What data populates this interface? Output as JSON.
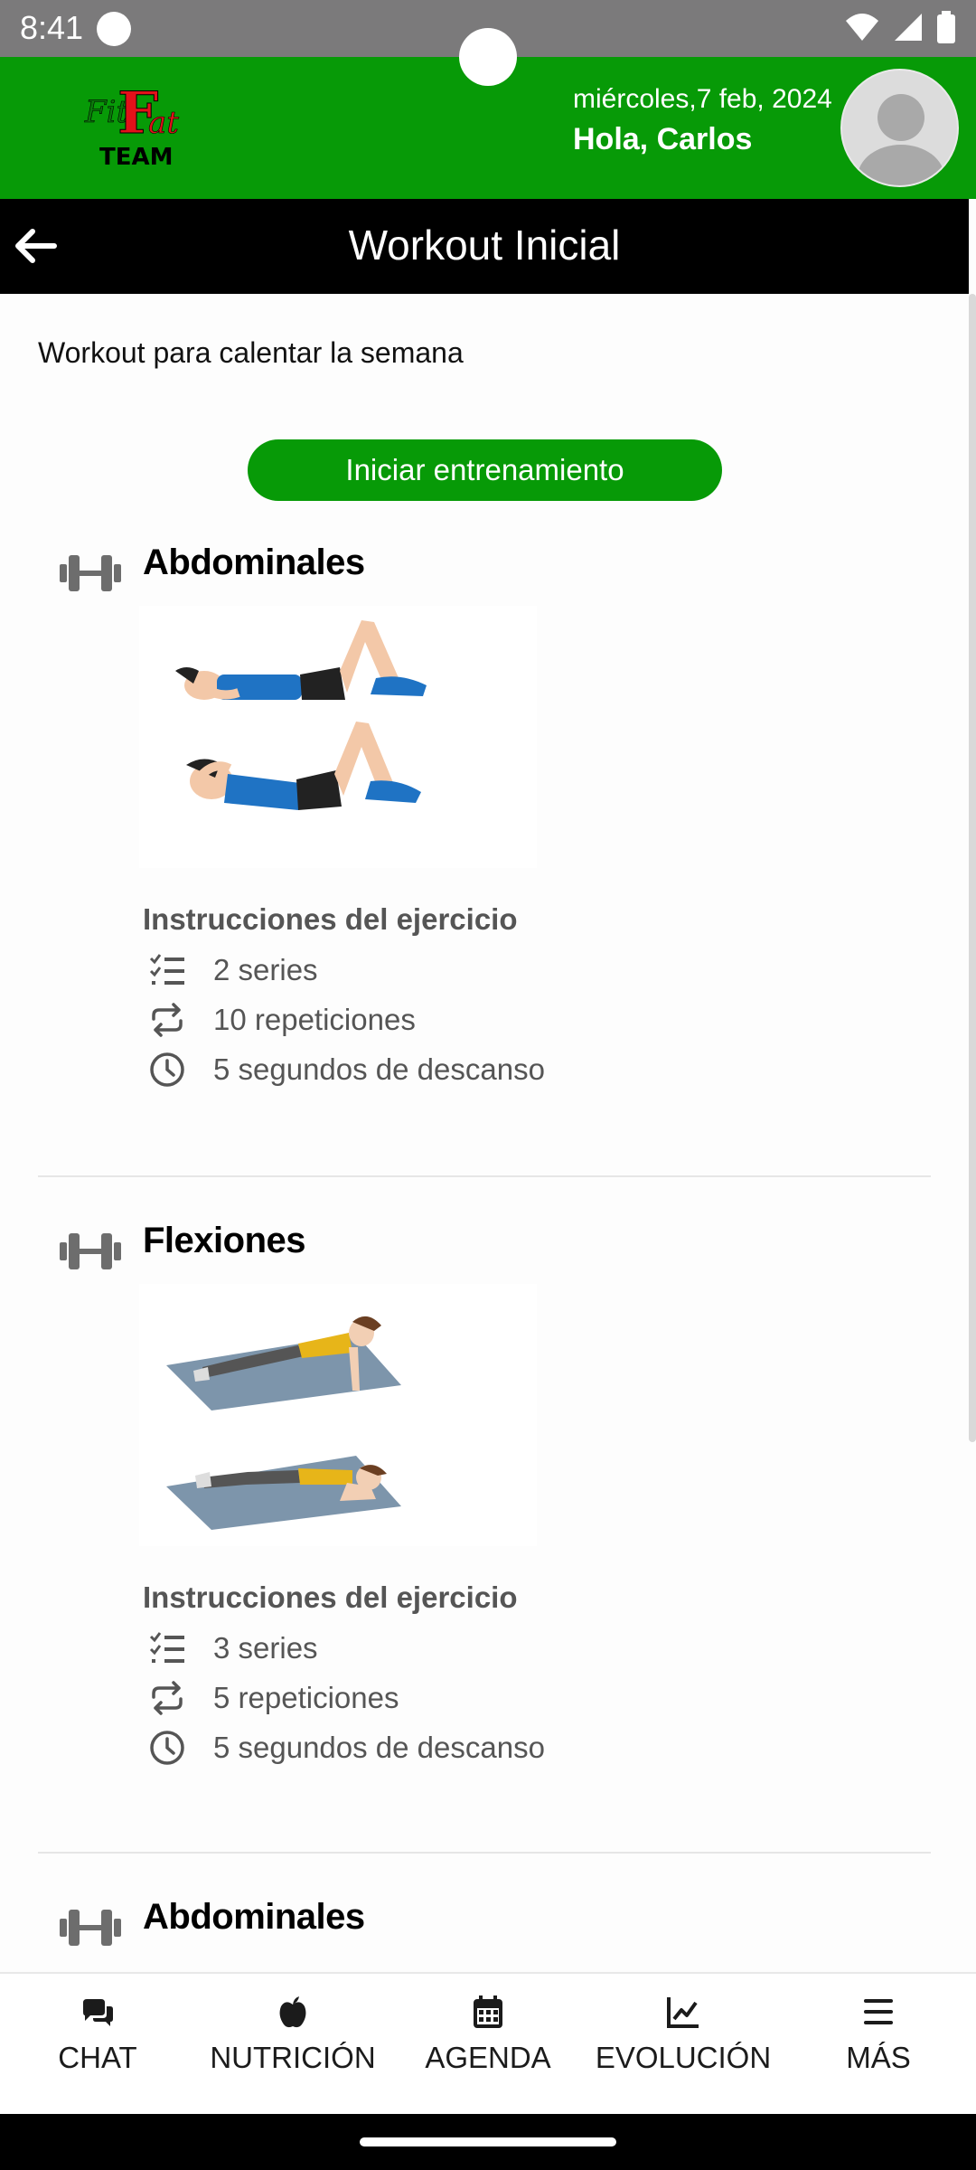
{
  "status_bar": {
    "time": "8:41"
  },
  "header": {
    "logo_text": "TEAM",
    "date": "miércoles,7 feb, 2024",
    "greeting": "Hola, Carlos",
    "brand_color": "#079a07"
  },
  "titlebar": {
    "title": "Workout Inicial"
  },
  "workout": {
    "description": "Workout para calentar la semana",
    "start_label": "Iniciar entrenamiento",
    "exercises": [
      {
        "name": "Abdominales",
        "instructions_title": "Instrucciones del ejercicio",
        "series": "2 series",
        "reps": "10 repeticiones",
        "rest": "5 segundos de descanso"
      },
      {
        "name": "Flexiones",
        "instructions_title": "Instrucciones del ejercicio",
        "series": "3 series",
        "reps": "5 repeticiones",
        "rest": "5 segundos de descanso"
      },
      {
        "name": "Abdominales"
      }
    ]
  },
  "bottom_nav": [
    {
      "label": "CHAT",
      "icon": "chat-icon"
    },
    {
      "label": "NUTRICIÓN",
      "icon": "apple-icon"
    },
    {
      "label": "AGENDA",
      "icon": "calendar-icon"
    },
    {
      "label": "EVOLUCIÓN",
      "icon": "chart-icon"
    },
    {
      "label": "MÁS",
      "icon": "menu-icon"
    }
  ]
}
